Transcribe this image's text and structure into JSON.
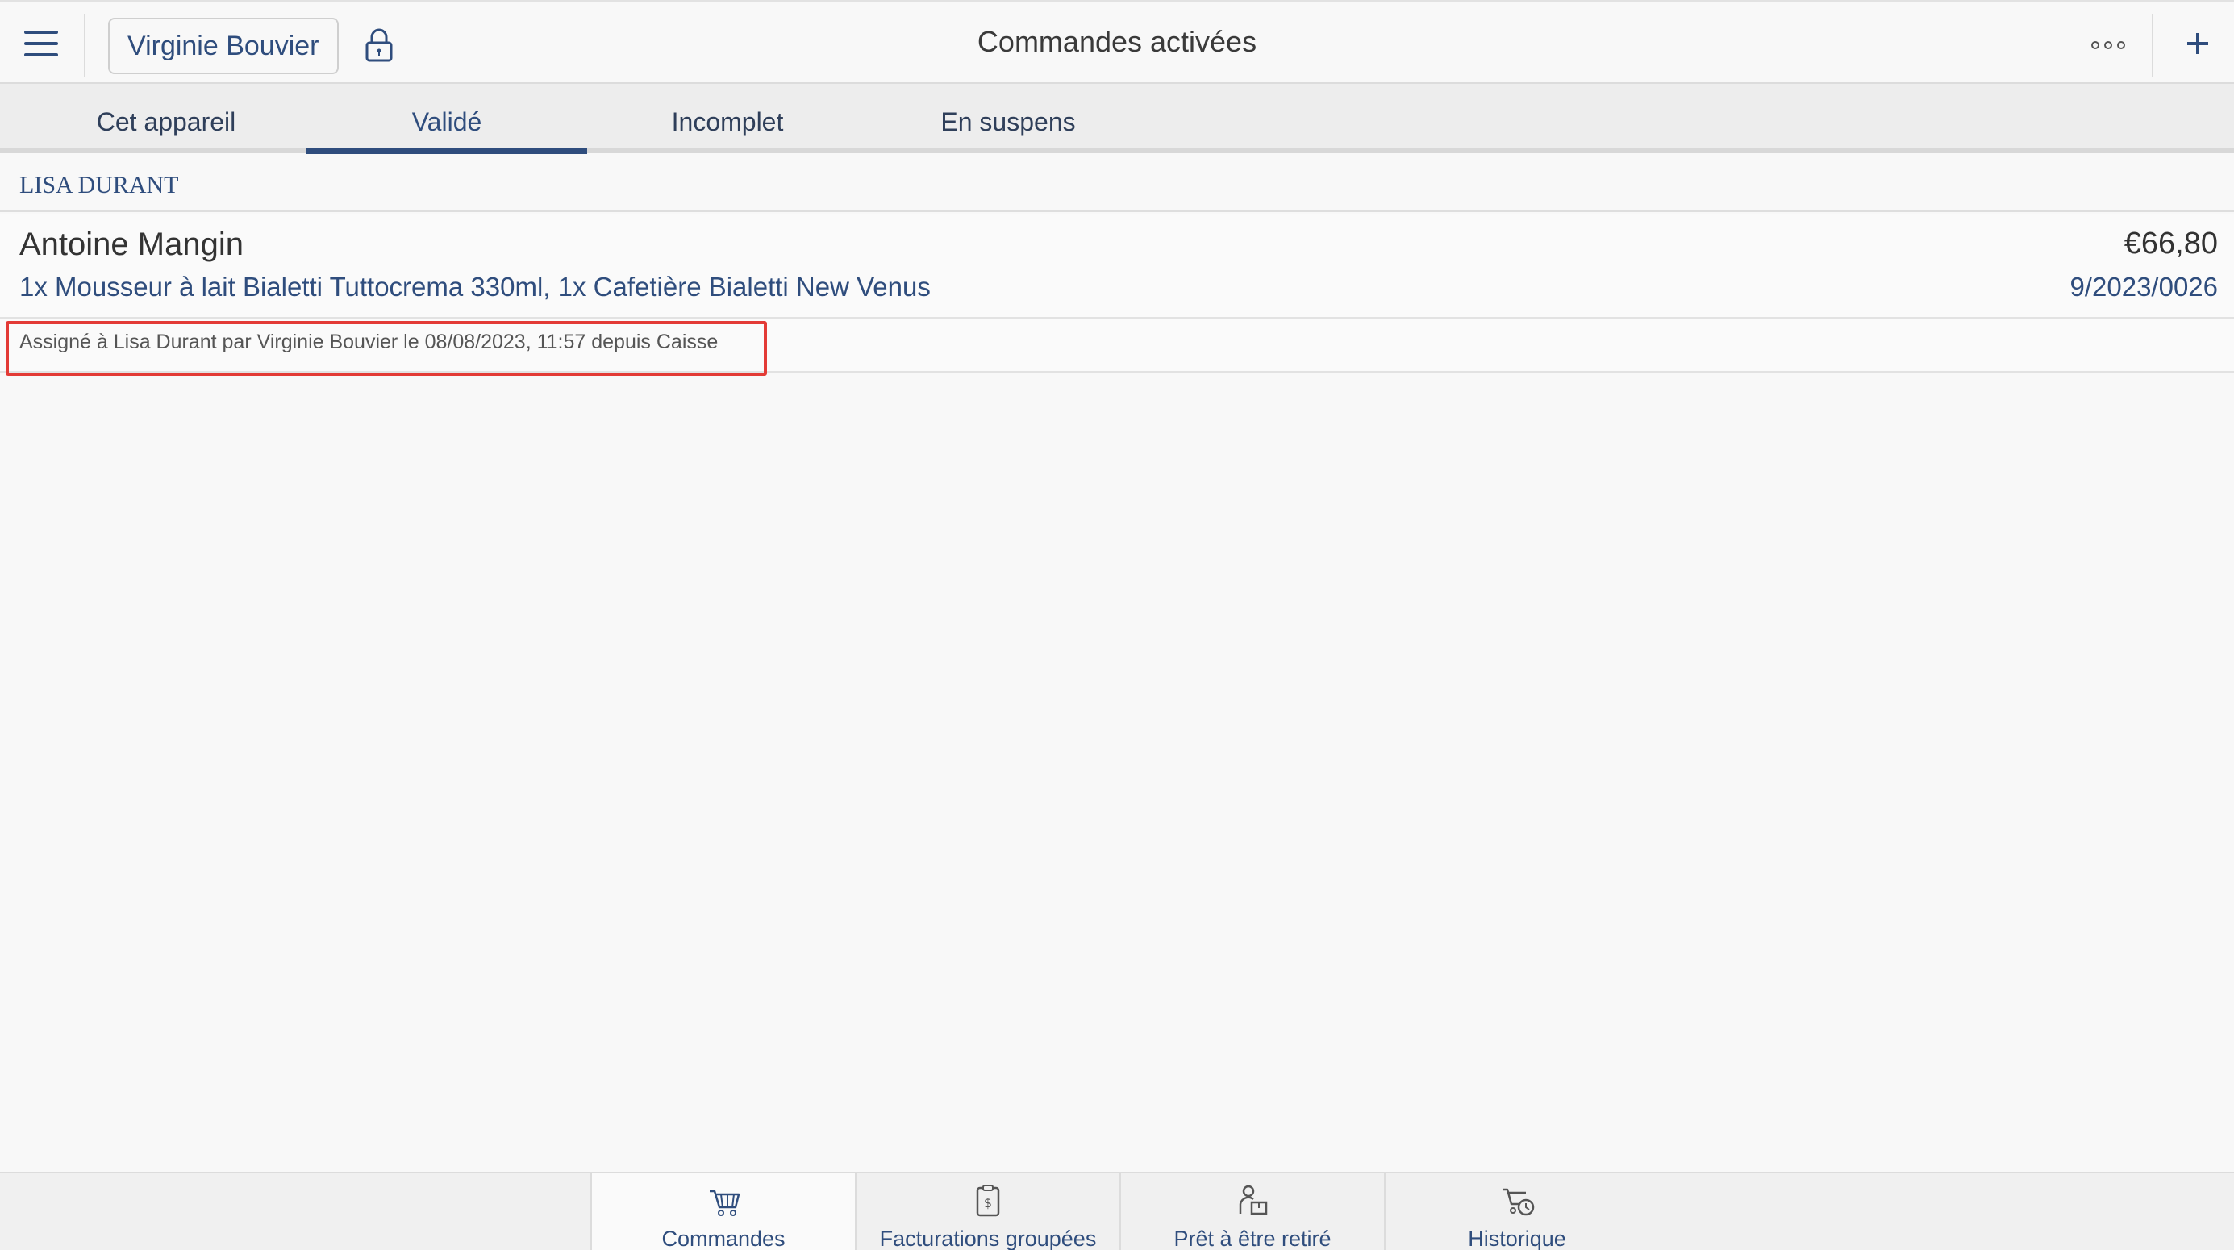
{
  "header": {
    "user_button": "Virginie Bouvier",
    "title": "Commandes activées",
    "icons": {
      "menu": "menu-icon",
      "lock": "lock-icon",
      "more": "more-icon",
      "add": "plus-icon"
    }
  },
  "tabs": [
    {
      "label": "Cet appareil",
      "active": false
    },
    {
      "label": "Validé",
      "active": true
    },
    {
      "label": "Incomplet",
      "active": false
    },
    {
      "label": "En suspens",
      "active": false
    }
  ],
  "section": {
    "title": "LISA DURANT"
  },
  "order": {
    "customer": "Antoine Mangin",
    "items": "1x Mousseur à lait Bialetti Tuttocrema 330ml, 1x Cafetière Bialetti New Venus",
    "amount": "€66,80",
    "reference": "9/2023/0026",
    "assignment": "Assigné à Lisa Durant par Virginie Bouvier le 08/08/2023, 11:57 depuis Caisse"
  },
  "bottom_nav": [
    {
      "label": "Commandes",
      "icon": "cart-icon",
      "active": true
    },
    {
      "label": "Facturations groupées",
      "icon": "invoice-icon",
      "active": false
    },
    {
      "label": "Prêt à être retiré",
      "icon": "pickup-icon",
      "active": false
    },
    {
      "label": "Historique",
      "icon": "history-icon",
      "active": false
    }
  ],
  "colors": {
    "accent": "#2f4d7d",
    "highlight": "#e33b36",
    "background": "#f8f8f8"
  }
}
